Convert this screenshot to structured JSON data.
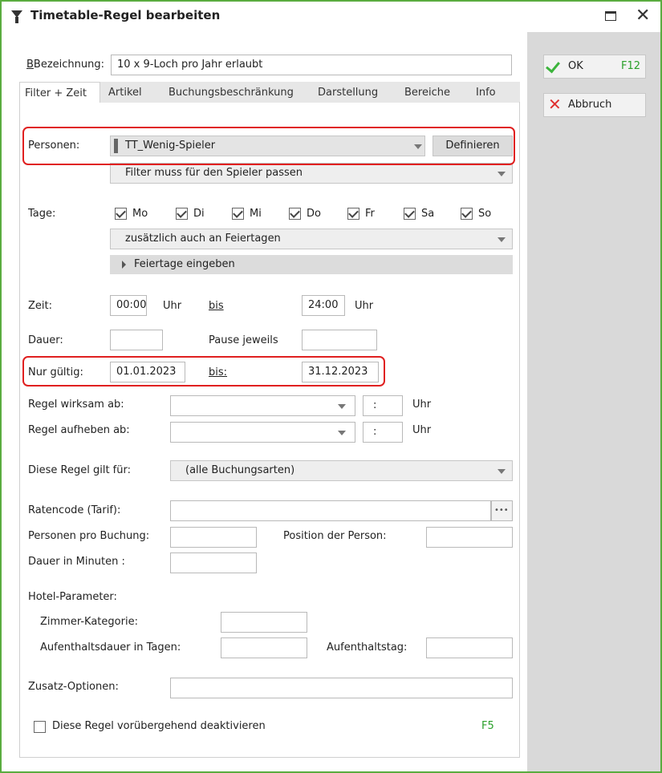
{
  "window": {
    "title": "Timetable-Regel bearbeiten"
  },
  "buttons": {
    "ok": {
      "label": "OK",
      "shortcut": "F12"
    },
    "cancel": {
      "label": "Abbruch"
    }
  },
  "form": {
    "bezeichnung_label": "Bezeichnung:",
    "bezeichnung_value": "10 x 9-Loch pro Jahr erlaubt"
  },
  "tabs": [
    {
      "label": "Filter + Zeit"
    },
    {
      "label": "Artikel"
    },
    {
      "label": "Buchungsbeschränkung"
    },
    {
      "label": "Darstellung"
    },
    {
      "label": "Bereiche"
    },
    {
      "label": "Info"
    }
  ],
  "personen": {
    "label": "Personen:",
    "value": "TT_Wenig-Spieler",
    "define_label": "Definieren",
    "filter_value": "Filter muss für den Spieler passen"
  },
  "tage": {
    "label": "Tage:",
    "days": [
      {
        "label": "Mo",
        "checked": true
      },
      {
        "label": "Di",
        "checked": true
      },
      {
        "label": "Mi",
        "checked": true
      },
      {
        "label": "Do",
        "checked": true
      },
      {
        "label": "Fr",
        "checked": true
      },
      {
        "label": "Sa",
        "checked": true
      },
      {
        "label": "So",
        "checked": true
      }
    ],
    "holiday_value": "zusätzlich auch an Feiertagen",
    "holiday_expand": "Feiertage eingeben"
  },
  "zeit": {
    "label": "Zeit:",
    "from": "00:00",
    "unit": "Uhr",
    "bis": "bis",
    "to": "24:00",
    "unit2": "Uhr"
  },
  "dauer": {
    "label": "Dauer:",
    "value": "",
    "pause_label": "Pause jeweils",
    "pause_value": ""
  },
  "gueltig": {
    "label": "Nur gültig:",
    "from": "01.01.2023",
    "bis": "bis:",
    "to": "31.12.2023"
  },
  "wirksam": {
    "label": "Regel wirksam ab:",
    "time_sep": ":",
    "unit": "Uhr"
  },
  "aufheben": {
    "label": "Regel aufheben ab:",
    "time_sep": ":",
    "unit": "Uhr"
  },
  "gilt_fuer": {
    "label": "Diese Regel gilt für:",
    "value": "(alle Buchungsarten)"
  },
  "ratencode": {
    "label": "Ratencode (Tarif):",
    "browse": "•••"
  },
  "personen_buchung": {
    "label": "Personen pro Buchung:",
    "position_label": "Position der Person:"
  },
  "dauer_min": {
    "label": "Dauer in Minuten  :"
  },
  "hotel": {
    "label": "Hotel-Parameter:",
    "zimmer_label": "Zimmer-Kategorie:",
    "aufenthalt_label": "Aufenthaltsdauer in Tagen:",
    "aufenthaltstag_label": "Aufenthaltstag:"
  },
  "zusatz": {
    "label": "Zusatz-Optionen:"
  },
  "deactivate": {
    "label": "Diese Regel vorübergehend deaktivieren",
    "checked": false,
    "shortcut": "F5"
  },
  "colors": {
    "accent": "#5aac3f",
    "highlight": "#e02020",
    "ok_check": "#3cb43c",
    "cancel_x": "#e03030"
  }
}
